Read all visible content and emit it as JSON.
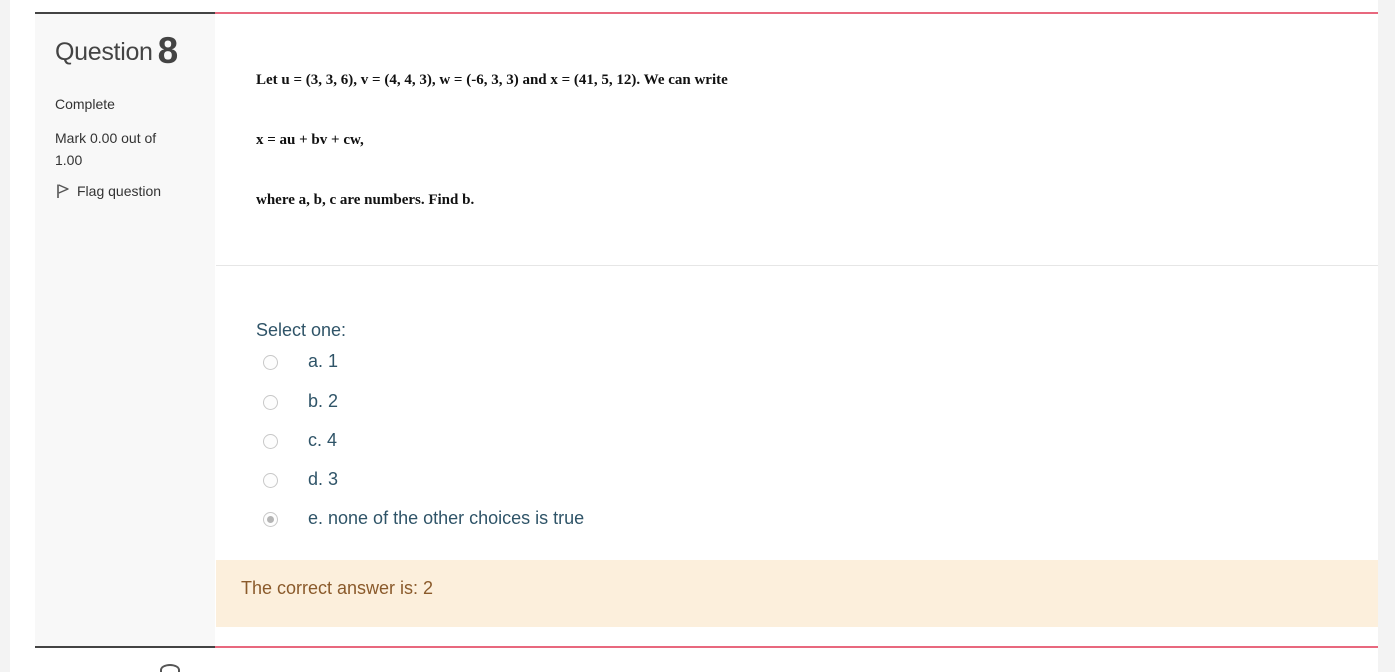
{
  "question": {
    "title_word": "Question",
    "number": "8",
    "state": "Complete",
    "grade": "Mark 0.00 out of 1.00",
    "flag_label": "Flag question"
  },
  "question_text": {
    "line1": "Let u = (3, 3, 6), v = (4, 4, 3), w = (-6, 3, 3) and x = (41, 5, 12). We can write",
    "line2": "x = au + bv + cw,",
    "line3": "where a, b, c are numbers. Find b."
  },
  "answer": {
    "prompt": "Select one:",
    "options": [
      {
        "label": "a. 1",
        "selected": false
      },
      {
        "label": "b. 2",
        "selected": false
      },
      {
        "label": "c. 4",
        "selected": false
      },
      {
        "label": "d. 3",
        "selected": false
      },
      {
        "label": "e. none of the other choices is true",
        "selected": true
      }
    ]
  },
  "feedback": {
    "right_answer": "The correct answer is: 2"
  },
  "colors": {
    "accent_rule": "#e8687e",
    "feedback_bg": "#fcefdc",
    "option_text": "#2f5468"
  },
  "icons": {
    "flag": "flag-icon"
  }
}
